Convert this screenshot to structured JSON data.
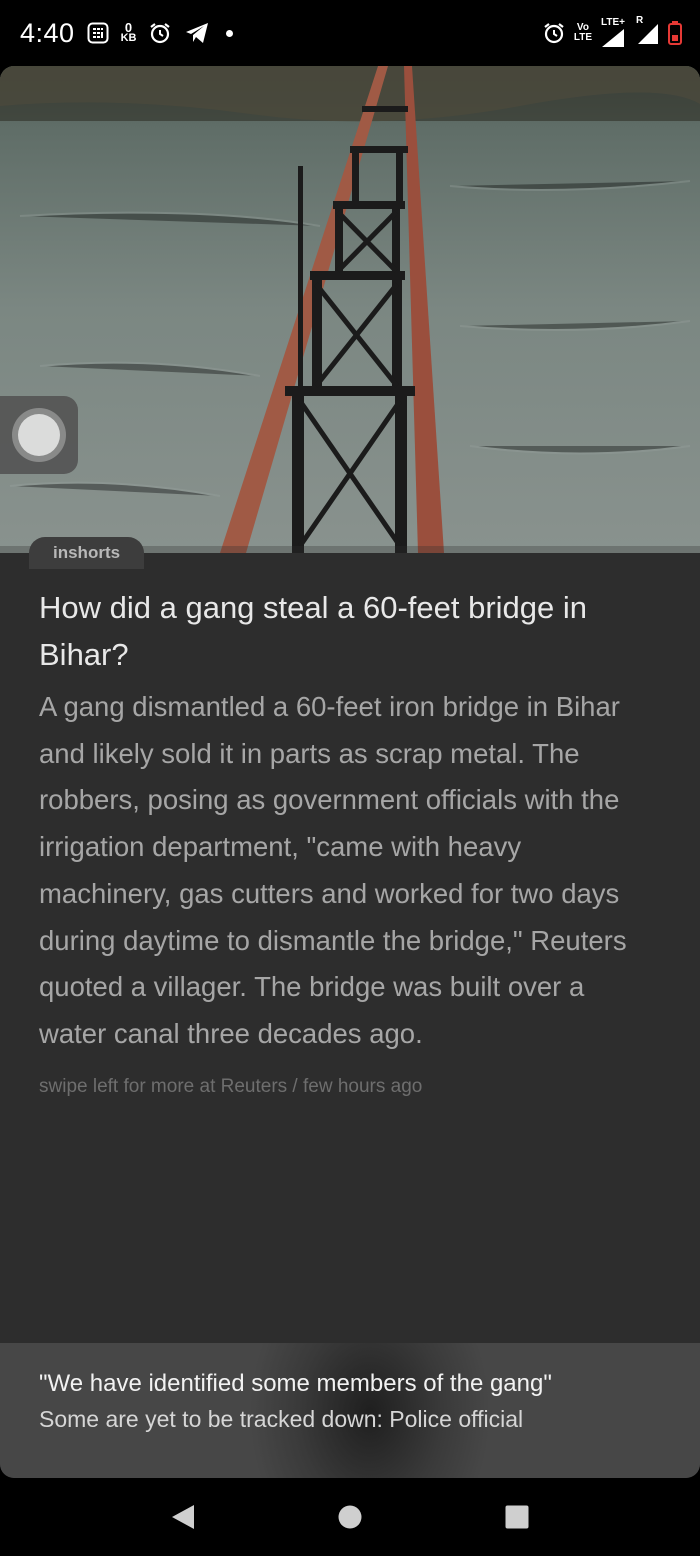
{
  "status_bar": {
    "time": "4:40",
    "data_speed_value": "0",
    "data_speed_unit": "KB",
    "network_label_top": "Vo",
    "network_label_bottom": "LTE",
    "lte_plus": "LTE+",
    "roaming": "R",
    "icons": [
      "calculator-icon",
      "alarm-icon",
      "telegram-icon",
      "notification-dot",
      "alarm-icon",
      "volte-icon",
      "signal-icon",
      "signal-roaming-icon",
      "battery-low-icon"
    ]
  },
  "article": {
    "source": "inshorts",
    "headline": "How did a gang steal a 60-feet bridge in Bihar?",
    "body": "A gang dismantled a 60-feet iron bridge in Bihar and likely sold it in parts as scrap metal. The robbers, posing as government officials with the irrigation department, \"came with heavy machinery, gas cutters and worked for two days during daytime to dismantle the bridge,\" Reuters quoted a villager. The bridge was built over a water canal three decades ago.",
    "meta": "swipe left for more at Reuters / few hours ago"
  },
  "banner": {
    "title": "\"We have identified some members of the gang\"",
    "subtitle": "Some are yet to be tracked down: Police official"
  },
  "colors": {
    "card_bg": "#2d2d2d",
    "battery_red": "#e53935"
  }
}
